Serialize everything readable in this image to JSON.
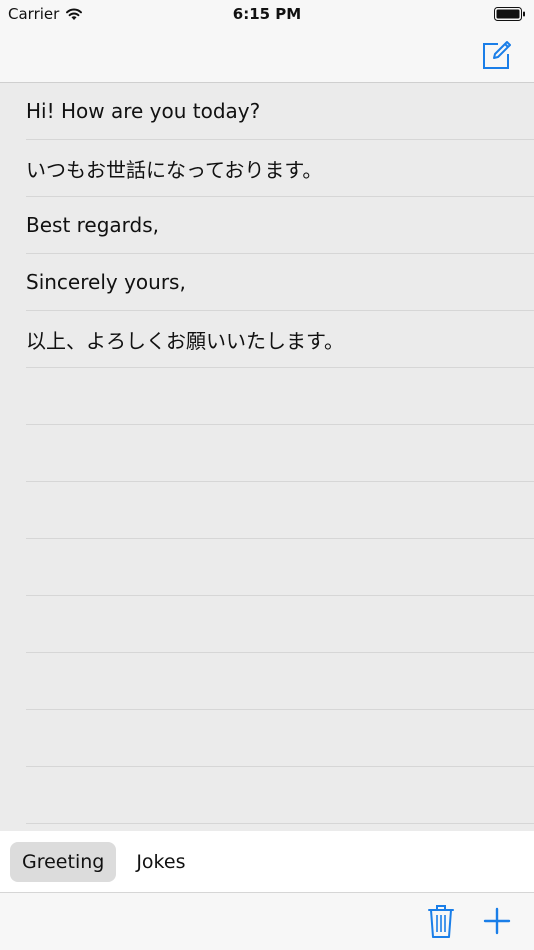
{
  "status_bar": {
    "carrier": "Carrier",
    "time": "6:15 PM"
  },
  "nav": {
    "compose_icon": "compose-icon",
    "accent_color": "#1a7ee8"
  },
  "phrases": [
    "Hi! How are you today?",
    "いつもお世話になっております。",
    "Best regards,",
    "Sincerely yours,",
    "以上、よろしくお願いいたします。",
    "",
    "",
    "",
    "",
    "",
    "",
    "",
    ""
  ],
  "tabs": [
    {
      "label": "Greeting",
      "selected": true
    },
    {
      "label": "Jokes",
      "selected": false
    }
  ],
  "toolbar": {
    "trash_icon": "trash-icon",
    "add_icon": "plus-icon"
  }
}
